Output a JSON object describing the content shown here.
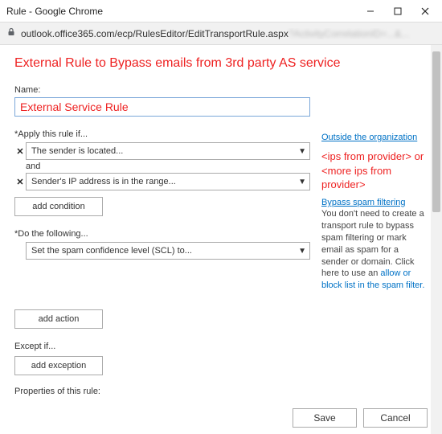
{
  "window": {
    "title": "Rule - Google Chrome",
    "url_visible": "outlook.office365.com/ecp/RulesEditor/EditTransportRule.aspx",
    "url_blur": "?ActivityCorrelationID=...&..."
  },
  "heading": "External Rule to Bypass emails from 3rd party AS service",
  "name_label": "Name:",
  "name_value": "External Service Rule",
  "apply_label": "*Apply this rule if...",
  "cond1": "The sender is located...",
  "and_label": "and",
  "cond2": "Sender's IP address is in the range...",
  "add_condition": "add condition",
  "do_label": "*Do the following...",
  "action1": "Set the spam confidence level (SCL) to...",
  "add_action": "add action",
  "except_label": "Except if...",
  "add_exception": "add exception",
  "properties_label": "Properties of this rule:",
  "side": {
    "outside_link": "Outside the organization",
    "ips_note": "<ips from provider> or <more ips from provider>",
    "bypass_link": "Bypass spam filtering",
    "bypass_text_1": "You don't need to create a transport rule to bypass spam filtering or mark email as spam for a sender or domain. Click here to use an ",
    "allow_link": "allow or block list in the spam filter."
  },
  "footer": {
    "save": "Save",
    "cancel": "Cancel"
  }
}
